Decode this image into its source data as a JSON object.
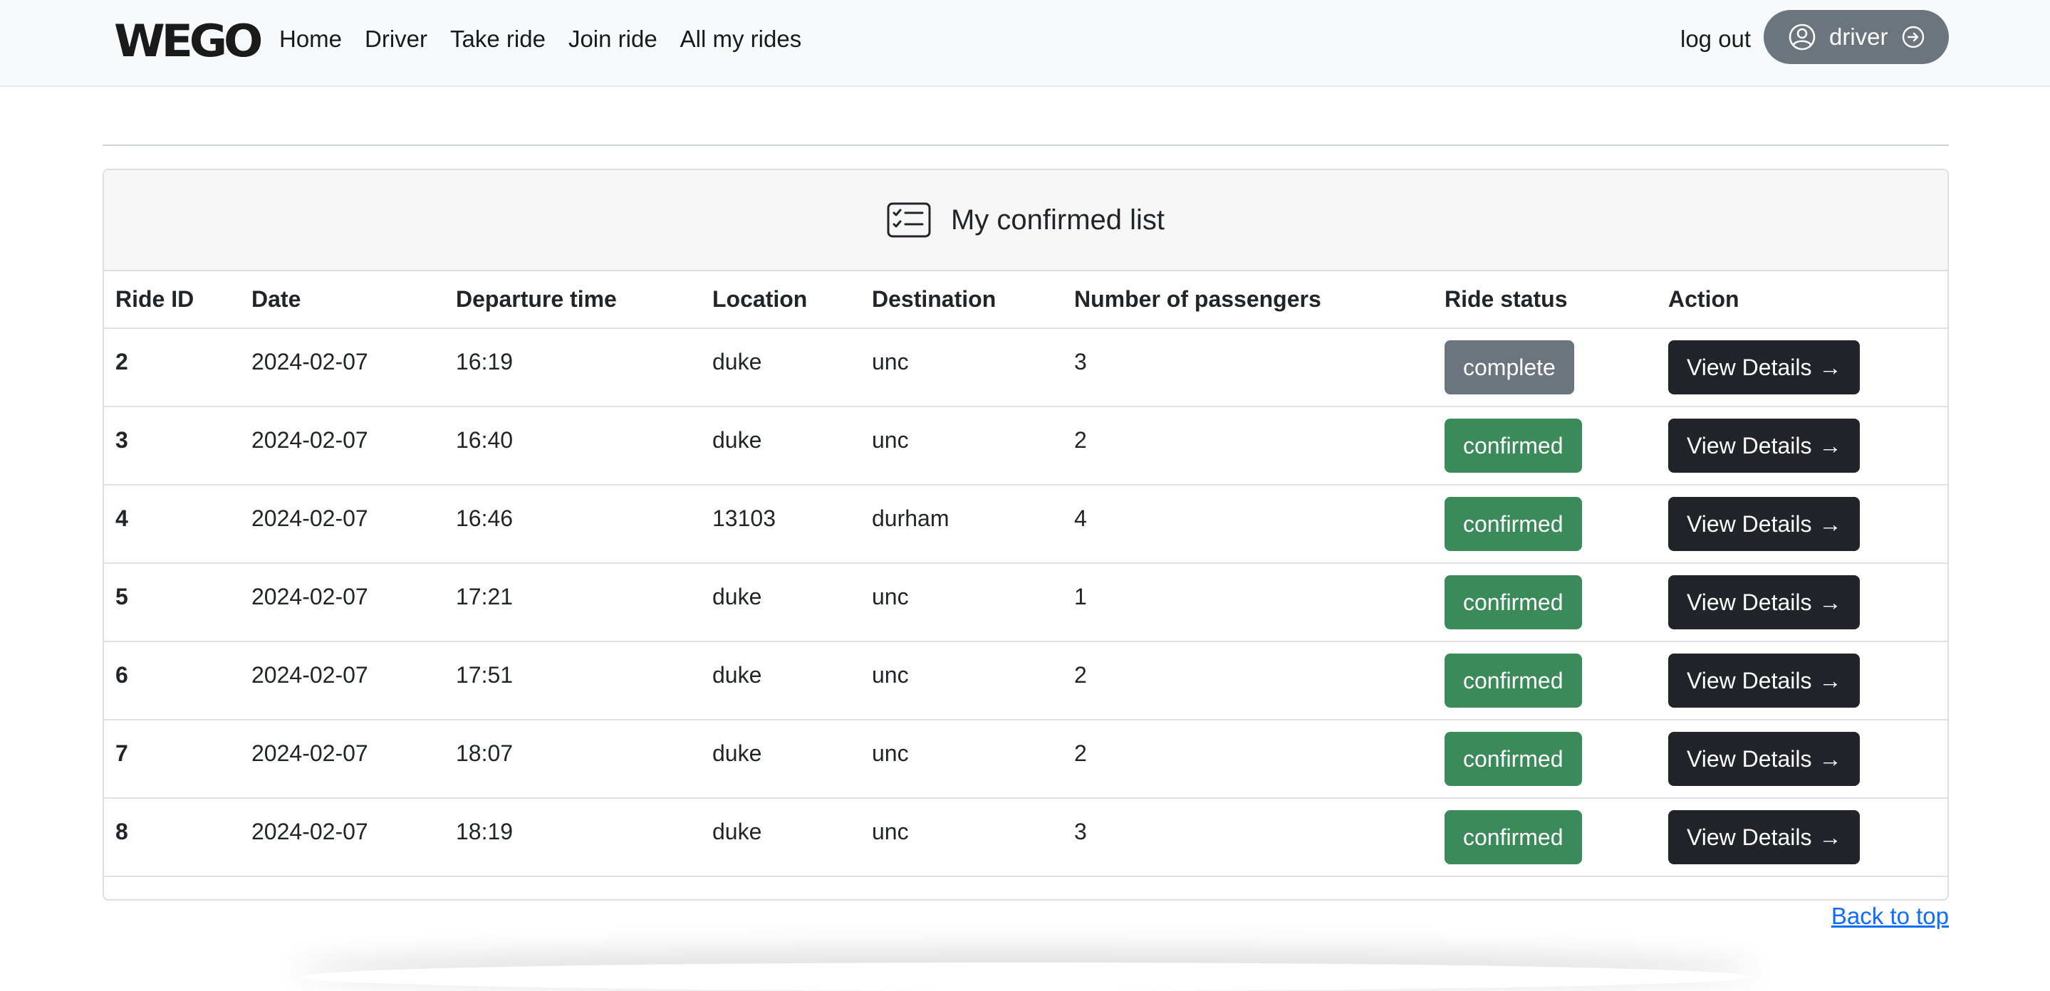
{
  "navbar": {
    "logo": "WEGO",
    "links": [
      "Home",
      "Driver",
      "Take ride",
      "Join ride",
      "All my rides"
    ],
    "logout": "log out",
    "user": {
      "label": "driver",
      "icon": "person-circle-icon",
      "arrow_icon": "arrow-right-circle-icon",
      "color": "#6c757d"
    }
  },
  "card": {
    "title": "My confirmed list",
    "icon": "card-checklist-icon",
    "columns": [
      "Ride ID",
      "Date",
      "Departure time",
      "Location",
      "Destination",
      "Number of passengers",
      "Ride status",
      "Action"
    ],
    "rows": [
      {
        "id": "2",
        "date": "2024-02-07",
        "time": "16:19",
        "location": "duke",
        "destination": "unc",
        "passengers": "3",
        "status": "complete"
      },
      {
        "id": "3",
        "date": "2024-02-07",
        "time": "16:40",
        "location": "duke",
        "destination": "unc",
        "passengers": "2",
        "status": "confirmed"
      },
      {
        "id": "4",
        "date": "2024-02-07",
        "time": "16:46",
        "location": "13103",
        "destination": "durham",
        "passengers": "4",
        "status": "confirmed"
      },
      {
        "id": "5",
        "date": "2024-02-07",
        "time": "17:21",
        "location": "duke",
        "destination": "unc",
        "passengers": "1",
        "status": "confirmed"
      },
      {
        "id": "6",
        "date": "2024-02-07",
        "time": "17:51",
        "location": "duke",
        "destination": "unc",
        "passengers": "2",
        "status": "confirmed"
      },
      {
        "id": "7",
        "date": "2024-02-07",
        "time": "18:07",
        "location": "duke",
        "destination": "unc",
        "passengers": "2",
        "status": "confirmed"
      },
      {
        "id": "8",
        "date": "2024-02-07",
        "time": "18:19",
        "location": "duke",
        "destination": "unc",
        "passengers": "3",
        "status": "confirmed"
      }
    ],
    "action_label": "View Details",
    "action_arrow": "→",
    "status_colors": {
      "complete": "#6c757d",
      "confirmed": "#3a8a5a"
    },
    "button_color": "#212529"
  },
  "footer": {
    "back_to_top": "Back to top",
    "link_color": "#0d6efd"
  }
}
